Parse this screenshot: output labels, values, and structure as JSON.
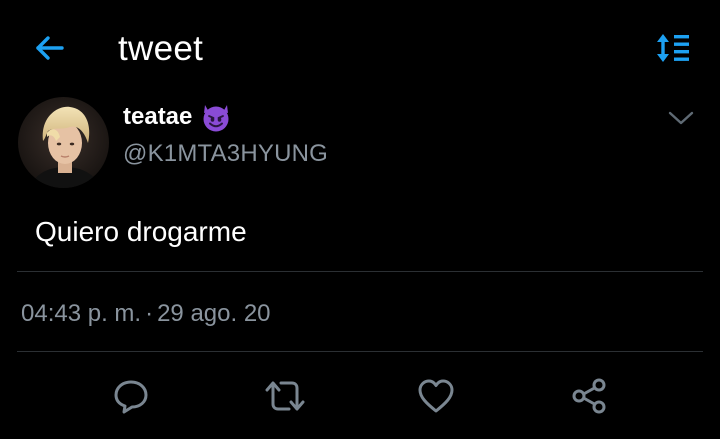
{
  "header": {
    "title": "tweet",
    "back_icon": "arrow-left-icon",
    "sort_icon": "sort-icon",
    "accent_color": "#1da1f2"
  },
  "tweet": {
    "display_name": "teatae",
    "name_emoji": "😈",
    "handle": "@K1MTA3HYUNG",
    "text": "Quiero drogarme",
    "time": "04:43 p. m.",
    "date_separator": "·",
    "date": "29 ago. 20"
  },
  "actions": {
    "reply_icon": "reply-icon",
    "retweet_icon": "retweet-icon",
    "like_icon": "heart-icon",
    "share_icon": "share-icon"
  },
  "colors": {
    "background": "#000000",
    "text_primary": "#ffffff",
    "text_secondary": "#8a949e",
    "divider": "#2b2f33",
    "icon_muted": "#7a8691"
  }
}
